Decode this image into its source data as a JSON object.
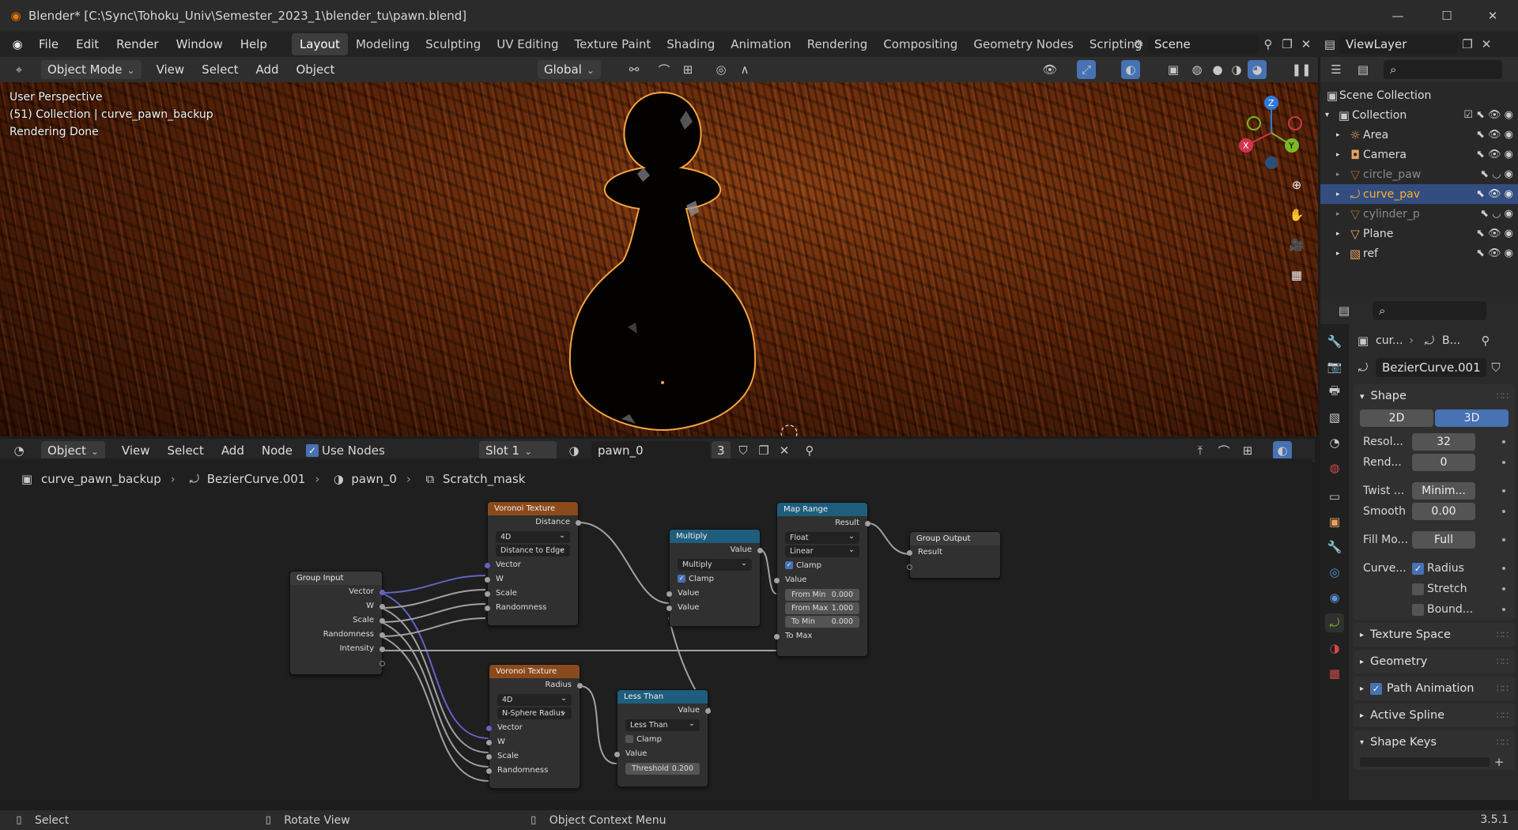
{
  "window": {
    "title": "Blender* [C:\\Sync\\Tohoku_Univ\\Semester_2023_1\\blender_tu\\pawn.blend]"
  },
  "menu": [
    "File",
    "Edit",
    "Render",
    "Window",
    "Help"
  ],
  "workspaces": [
    "Layout",
    "Modeling",
    "Sculpting",
    "UV Editing",
    "Texture Paint",
    "Shading",
    "Animation",
    "Rendering",
    "Compositing",
    "Geometry Nodes",
    "Scripting"
  ],
  "scene": {
    "name": "Scene",
    "view_layer": "ViewLayer"
  },
  "viewport_header": {
    "mode": "Object Mode",
    "menus": [
      "View",
      "Select",
      "Add",
      "Object"
    ],
    "orientation": "Global"
  },
  "viewport": {
    "info_lines": [
      "User Perspective",
      "(51) Collection | curve_pawn_backup",
      "Rendering Done"
    ],
    "gizmo": {
      "x": "X",
      "y": "Y",
      "z": "Z"
    }
  },
  "node_header": {
    "type": "Object",
    "menus": [
      "View",
      "Select",
      "Add",
      "Node"
    ],
    "use_nodes": "Use Nodes",
    "slot": "Slot 1",
    "material": "pawn_0",
    "users": "3"
  },
  "breadcrumb": [
    "curve_pawn_backup",
    "BezierCurve.001",
    "pawn_0",
    "Scratch_mask"
  ],
  "nodes": {
    "group_input": {
      "title": "Group Input",
      "outputs": [
        "Vector",
        "W",
        "Scale",
        "Randomness",
        "Intensity"
      ]
    },
    "voronoi1": {
      "title": "Voronoi Texture",
      "output": "Distance",
      "dim": "4D",
      "feature": "Distance to Edge",
      "inputs": [
        "Vector",
        "W",
        "Scale",
        "Randomness"
      ]
    },
    "voronoi2": {
      "title": "Voronoi Texture",
      "output": "Radius",
      "dim": "4D",
      "feature": "N-Sphere Radius",
      "inputs": [
        "Vector",
        "W",
        "Scale",
        "Randomness"
      ]
    },
    "multiply": {
      "title": "Multiply",
      "output": "Value",
      "op": "Multiply",
      "clamp": "Clamp",
      "inputs": [
        "Value",
        "Value"
      ]
    },
    "lessthan": {
      "title": "Less Than",
      "output": "Value",
      "op": "Less Than",
      "clamp": "Clamp",
      "input": "Value",
      "threshold_label": "Threshold",
      "threshold": "0.200"
    },
    "maprange": {
      "title": "Map Range",
      "output": "Result",
      "type": "Float",
      "interp": "Linear",
      "clamp": "Clamp",
      "value": "Value",
      "from_min_label": "From Min",
      "from_min": "0.000",
      "from_max_label": "From Max",
      "from_max": "1.000",
      "to_min_label": "To Min",
      "to_min": "0.000",
      "to_max": "To Max"
    },
    "group_output": {
      "title": "Group Output",
      "input": "Result"
    }
  },
  "outliner": {
    "root": "Scene Collection",
    "collection": "Collection",
    "items": [
      "Area",
      "Camera",
      "circle_paw",
      "curve_pav",
      "cylinder_p",
      "Plane",
      "ref"
    ]
  },
  "properties": {
    "breadcrumb": [
      "cur...",
      "B..."
    ],
    "data_name": "BezierCurve.001",
    "shape": {
      "title": "Shape",
      "d2": "2D",
      "d3": "3D",
      "resol_label": "Resol...",
      "resol": "32",
      "rend_label": "Rend...",
      "rend": "0",
      "twist_label": "Twist ...",
      "twist": "Minim...",
      "smooth_label": "Smooth",
      "smooth": "0.00",
      "fill_label": "Fill Mo...",
      "fill": "Full",
      "curve_label": "Curve...",
      "radius": "Radius",
      "stretch": "Stretch",
      "bound": "Bound..."
    },
    "panels": [
      "Texture Space",
      "Geometry",
      "Path Animation",
      "Active Spline",
      "Shape Keys"
    ]
  },
  "status": {
    "select": "Select",
    "rotate": "Rotate View",
    "context": "Object Context Menu",
    "version": "3.5.1"
  },
  "colors": {
    "accent": "#4772b3",
    "selection": "#f5a442",
    "node_texture": "#8b4a1c",
    "node_math": "#1e5e7c"
  }
}
